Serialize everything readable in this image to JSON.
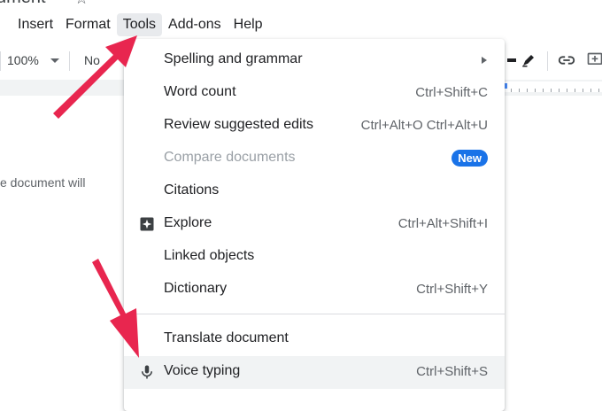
{
  "window": {
    "title_fragment": "ument",
    "star_glyph": "☆"
  },
  "menubar": {
    "items": [
      {
        "label": "Insert",
        "active": false
      },
      {
        "label": "Format",
        "active": false
      },
      {
        "label": "Tools",
        "active": true
      },
      {
        "label": "Add-ons",
        "active": false
      },
      {
        "label": "Help",
        "active": false
      }
    ]
  },
  "toolbar": {
    "zoom": "100%",
    "style_fragment": "No"
  },
  "document": {
    "text_fragment": "e document will"
  },
  "tools_menu": {
    "items": [
      {
        "label": "Spelling and grammar",
        "submenu": true
      },
      {
        "label": "Word count",
        "shortcut": "Ctrl+Shift+C"
      },
      {
        "label": "Review suggested edits",
        "shortcut": "Ctrl+Alt+O Ctrl+Alt+U"
      },
      {
        "label": "Compare documents",
        "disabled": true,
        "badge": "New"
      },
      {
        "label": "Citations"
      },
      {
        "label": "Explore",
        "shortcut": "Ctrl+Alt+Shift+I",
        "icon": "explore-icon"
      },
      {
        "label": "Linked objects"
      },
      {
        "label": "Dictionary",
        "shortcut": "Ctrl+Shift+Y"
      },
      {
        "label": "Translate document"
      },
      {
        "label": "Voice typing",
        "shortcut": "Ctrl+Shift+S",
        "icon": "microphone-icon",
        "hovered": true
      }
    ]
  },
  "colors": {
    "annotation_arrow": "#e8264f",
    "badge": "#1a73e8",
    "active_menu": "#e8eaed",
    "hover_row": "#f1f3f4"
  }
}
